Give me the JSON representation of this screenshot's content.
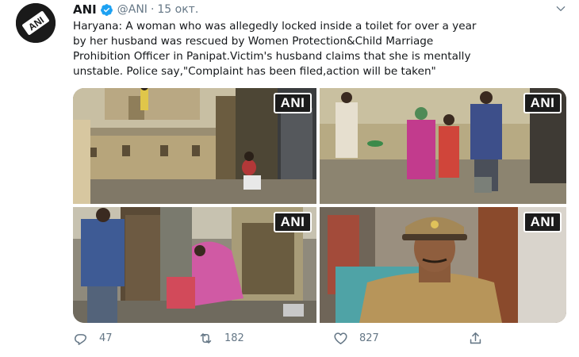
{
  "tweet": {
    "author_name": "ANI",
    "handle": "@ANI",
    "separator": "·",
    "date": "15 окт.",
    "avatar_icon": "ani-logo-icon",
    "verified_icon": "verified-badge-icon",
    "text_lines": [
      "Haryana: A woman who was allegedly locked inside a toilet for over a year",
      "by her husband was rescued by Women Protection&Child Marriage",
      "Prohibition Officer in Panipat.Victim's husband claims that she is mentally",
      "unstable. Police say,\"Complaint has been filed,action will be taken\""
    ],
    "media": [
      {
        "watermark": "ANI"
      },
      {
        "watermark": "ANI"
      },
      {
        "watermark": "ANI"
      },
      {
        "watermark": "ANI"
      }
    ],
    "actions": {
      "reply_count": "47",
      "retweet_count": "182",
      "like_count": "827",
      "reply_icon": "reply-icon",
      "retweet_icon": "retweet-icon",
      "like_icon": "heart-icon",
      "share_icon": "share-icon"
    },
    "colors": {
      "verified": "#1da1f2",
      "muted": "#657786",
      "text": "#14171a"
    }
  }
}
